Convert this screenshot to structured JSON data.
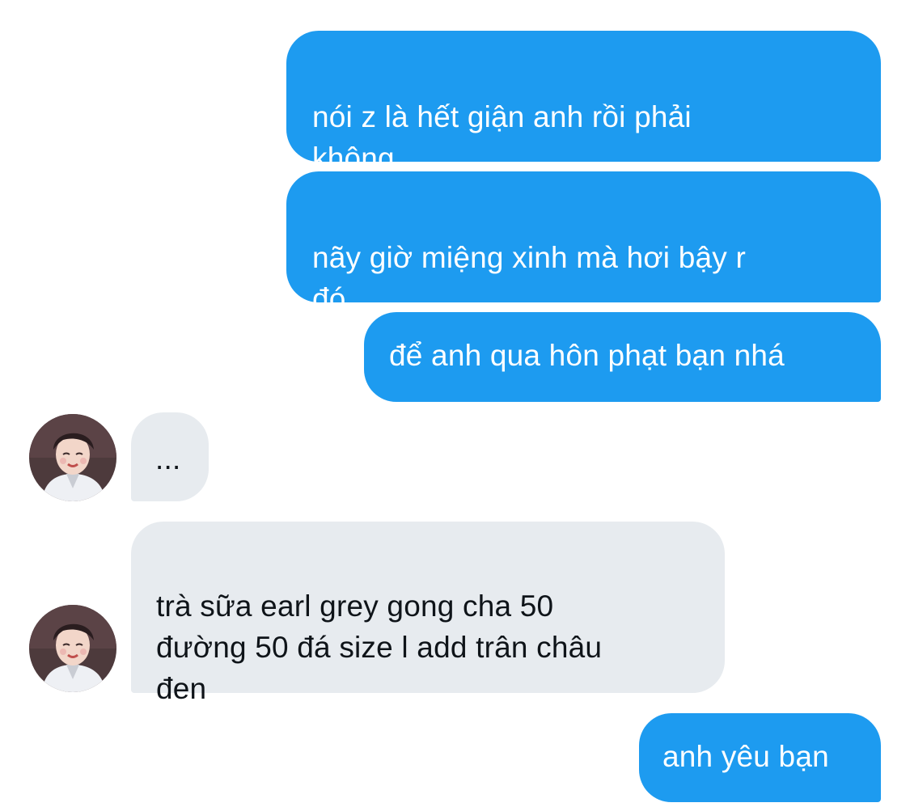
{
  "conversation": {
    "messages": [
      {
        "sender": "me",
        "text": "nói z là hết giận anh rồi phải\nkhông"
      },
      {
        "sender": "me",
        "text": "nãy giờ miệng xinh mà hơi bậy r\nđó"
      },
      {
        "sender": "me",
        "text": "để anh qua hôn phạt bạn nhá"
      },
      {
        "sender": "them",
        "text": "..."
      },
      {
        "sender": "them",
        "text": "trà sữa earl grey gong cha 50\nđường 50 đá size l add trân châu\nđen"
      },
      {
        "sender": "me",
        "text": "anh yêu bạn"
      }
    ]
  },
  "colors": {
    "outgoing_bubble": "#1d9bf0",
    "incoming_bubble": "#e7ebef",
    "outgoing_text": "#ffffff",
    "incoming_text": "#0f1419",
    "background": "#ffffff"
  },
  "icons": {
    "contact_avatar": "contact-avatar-photo"
  }
}
